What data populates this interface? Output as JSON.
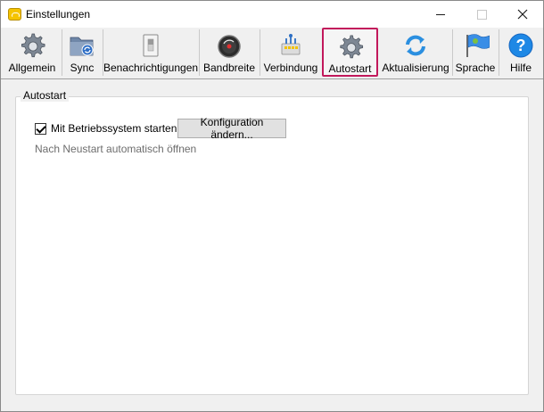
{
  "window": {
    "title": "Einstellungen",
    "controls": [
      "minimize",
      "maximize",
      "close"
    ]
  },
  "toolbar": {
    "items": [
      {
        "label": "Allgemein",
        "icon": "gear-icon",
        "active": false
      },
      {
        "label": "Sync",
        "icon": "folder-sync-icon",
        "active": false
      },
      {
        "label": "Benachrichtigungen",
        "icon": "notification-switch-icon",
        "active": false
      },
      {
        "label": "Bandbreite",
        "icon": "gauge-icon",
        "active": false
      },
      {
        "label": "Verbindung",
        "icon": "network-icon",
        "active": false
      },
      {
        "label": "Autostart",
        "icon": "gear-icon",
        "active": true
      },
      {
        "label": "Aktualisierung",
        "icon": "refresh-icon",
        "active": false
      },
      {
        "label": "Sprache",
        "icon": "flag-icon",
        "active": false
      },
      {
        "label": "Hilfe",
        "icon": "help-icon",
        "active": false
      }
    ],
    "active_color": "#c2185b"
  },
  "autostart": {
    "group_title": "Autostart",
    "checkbox_label": "Mit Betriebssystem starten",
    "checkbox_checked": true,
    "config_button": "Konfiguration ändern...",
    "hint": "Nach Neustart automatisch öffnen"
  }
}
